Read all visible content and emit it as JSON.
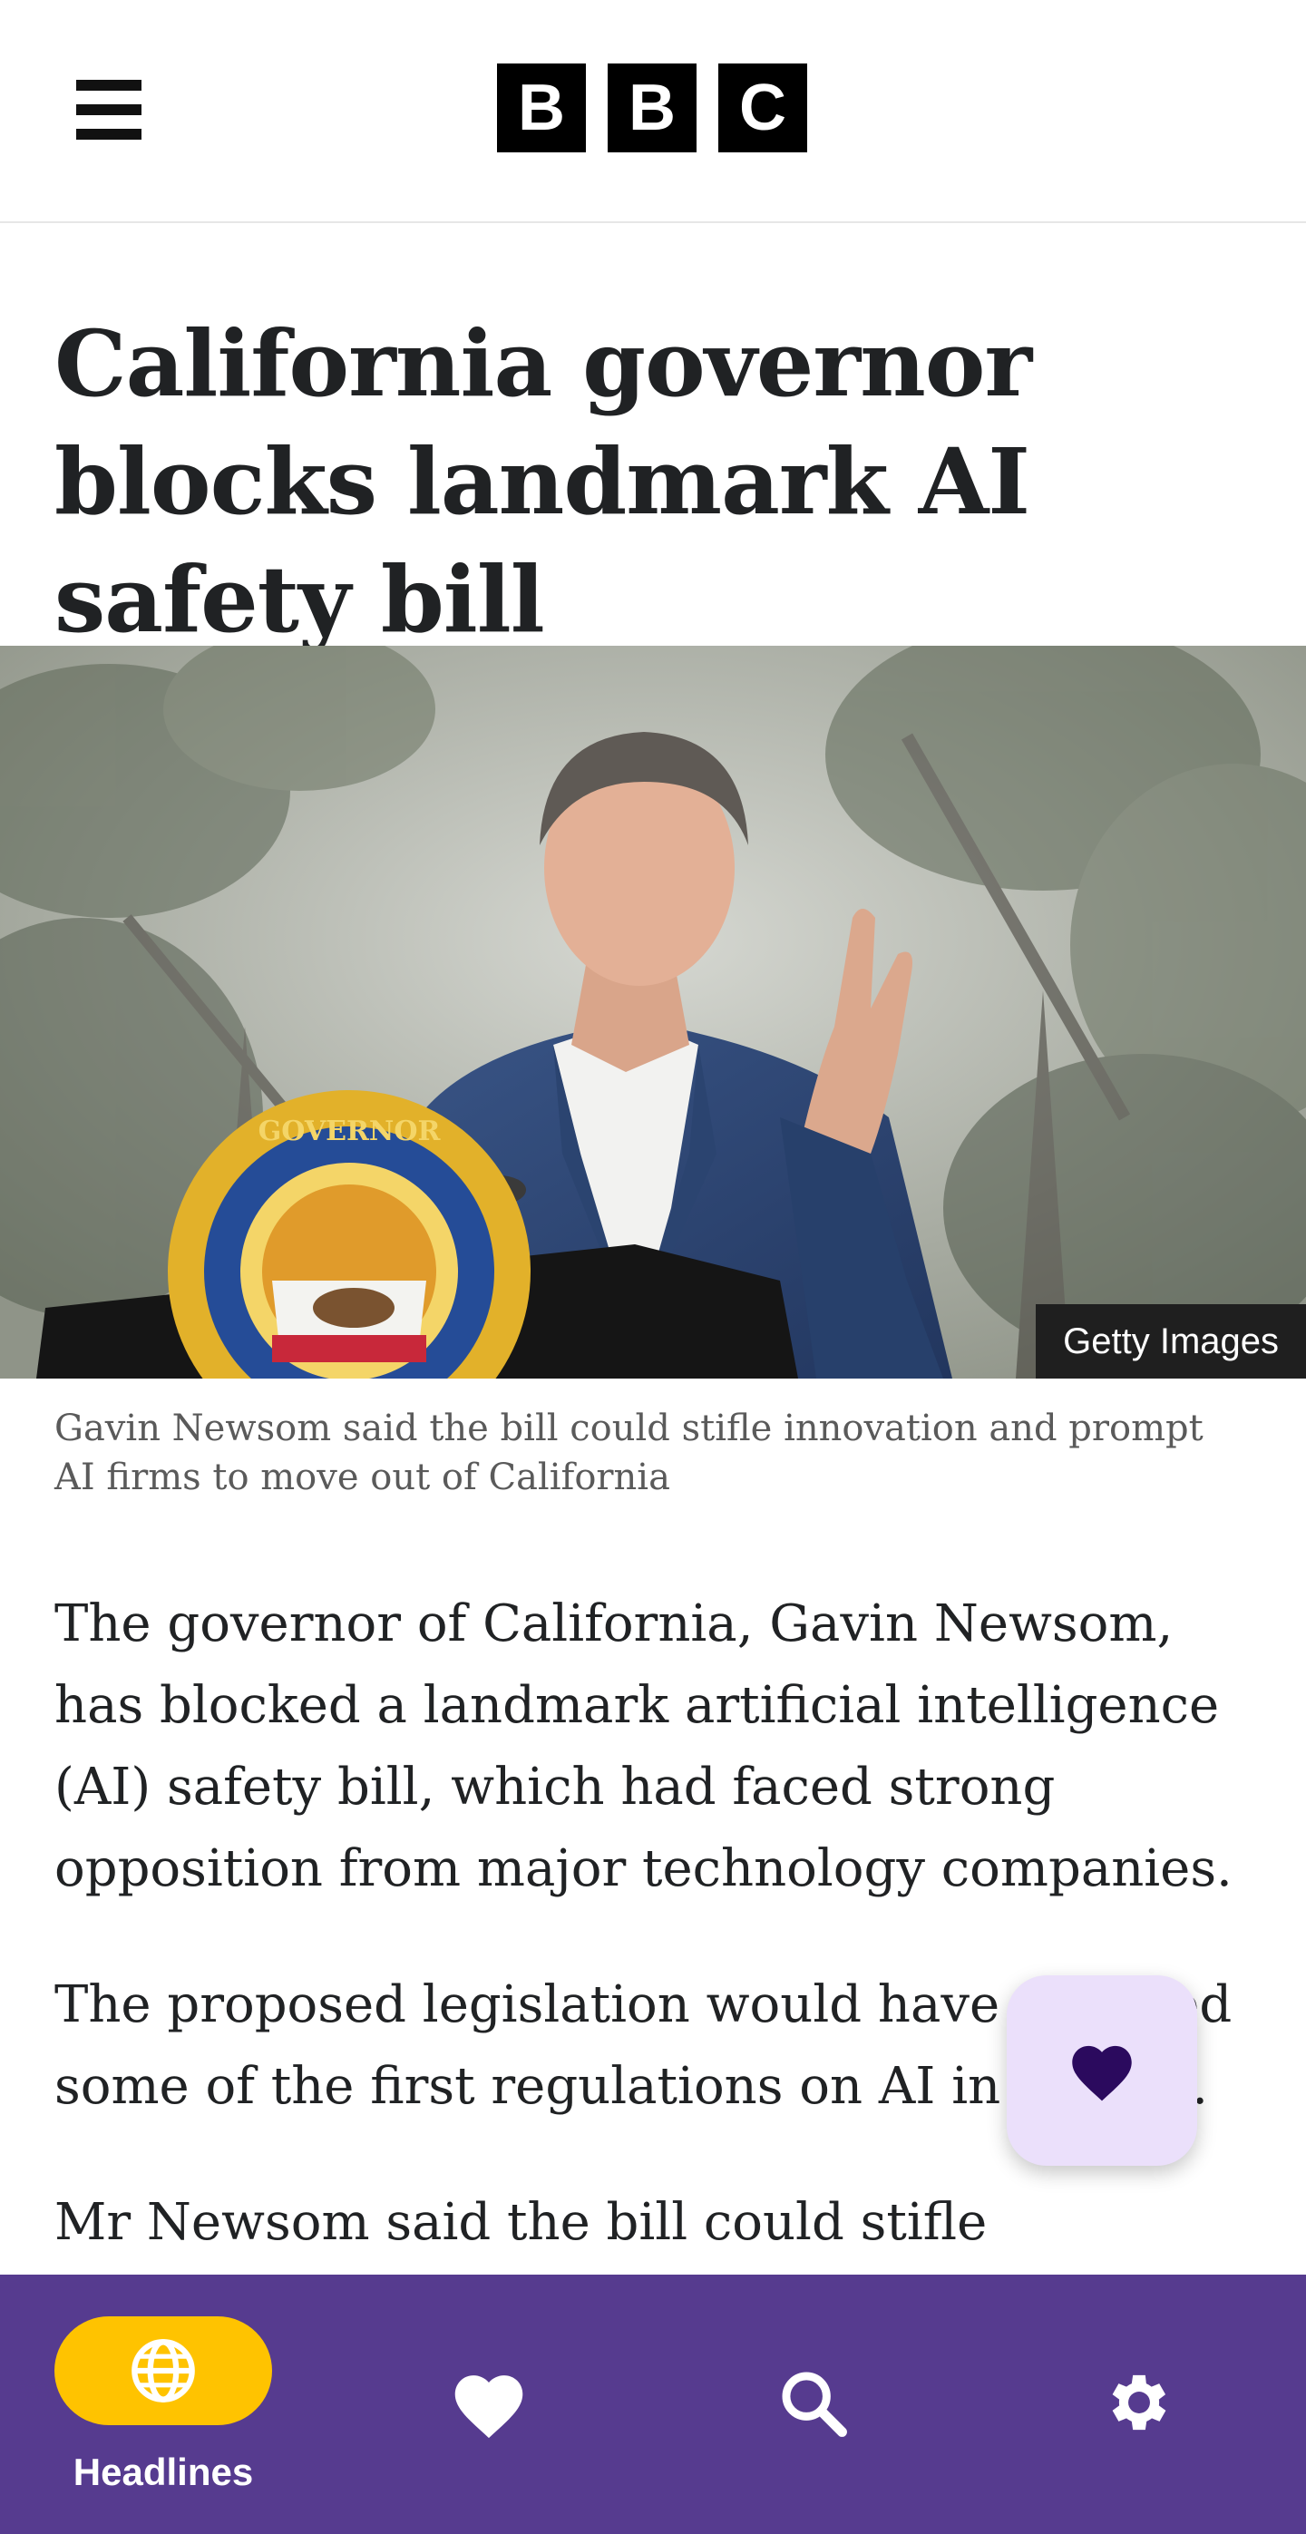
{
  "header": {
    "logo_letters": [
      "B",
      "B",
      "C"
    ],
    "menu_icon": "hamburger-menu-icon"
  },
  "article": {
    "headline": "California governor blocks landmark AI safety bill",
    "image_credit": "Getty Images",
    "caption": "Gavin Newsom said the bill could stifle innovation and prompt AI firms to move out of California",
    "paragraphs": [
      "The governor of California, Gavin Newsom, has blocked a landmark artificial intelligence (AI) safety bill, which had faced strong opposition from major technology companies.",
      "The proposed legislation would have imposed some of the first regulations on AI in the US.",
      "Mr Newsom said the bill could stifle innovation"
    ],
    "seal_text": "GOVERNOR OF THE STATE OF CALIFORNIA"
  },
  "fab": {
    "icon": "heart-icon"
  },
  "bottom_nav": {
    "items": [
      {
        "label": "Headlines",
        "icon": "globe-icon",
        "active": true
      },
      {
        "label": "",
        "icon": "heart-icon"
      },
      {
        "label": "",
        "icon": "search-icon"
      },
      {
        "label": "",
        "icon": "gear-icon"
      }
    ]
  },
  "colors": {
    "nav_background": "#563b8f",
    "nav_active_pill": "#ffc300",
    "fab_background": "#ebe0fb",
    "fab_icon": "#2b0a5e"
  }
}
